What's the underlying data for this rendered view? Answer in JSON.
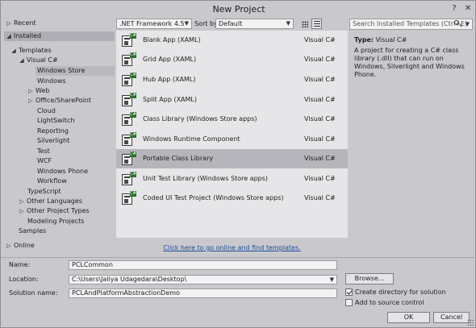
{
  "window": {
    "title": "New Project",
    "help_label": "?",
    "close_label": "✕"
  },
  "tree": [
    {
      "label": "Recent",
      "arrow": "▷",
      "kind": "collapsed"
    },
    {
      "label": "Installed",
      "arrow": "◢",
      "kind": "expanded-selected-parent"
    },
    {
      "label": "Templates",
      "arrow": "◢",
      "kind": "expanded"
    },
    {
      "label": "Visual C#",
      "arrow": "◢",
      "kind": "expanded"
    },
    {
      "label": "Windows Store",
      "arrow": "",
      "kind": "selected"
    },
    {
      "label": "Windows",
      "arrow": "",
      "kind": "leaf"
    },
    {
      "label": "Web",
      "arrow": "▷",
      "kind": "collapsed"
    },
    {
      "label": "Office/SharePoint",
      "arrow": "▷",
      "kind": "collapsed"
    },
    {
      "label": "Cloud",
      "arrow": "",
      "kind": "leaf"
    },
    {
      "label": "LightSwitch",
      "arrow": "",
      "kind": "leaf"
    },
    {
      "label": "Reporting",
      "arrow": "",
      "kind": "leaf"
    },
    {
      "label": "Silverlight",
      "arrow": "",
      "kind": "leaf"
    },
    {
      "label": "Test",
      "arrow": "",
      "kind": "leaf"
    },
    {
      "label": "WCF",
      "arrow": "",
      "kind": "leaf"
    },
    {
      "label": "Windows Phone",
      "arrow": "",
      "kind": "leaf"
    },
    {
      "label": "Workflow",
      "arrow": "",
      "kind": "leaf"
    },
    {
      "label": "TypeScript",
      "arrow": "",
      "kind": "leaf"
    },
    {
      "label": "Other Languages",
      "arrow": "▷",
      "kind": "collapsed"
    },
    {
      "label": "Other Project Types",
      "arrow": "▷",
      "kind": "collapsed"
    },
    {
      "label": "Modeling Projects",
      "arrow": "",
      "kind": "leaf"
    },
    {
      "label": "Samples",
      "arrow": "",
      "kind": "leaf"
    },
    {
      "label": "Online",
      "arrow": "▷",
      "kind": "collapsed"
    }
  ],
  "toolbar": {
    "framework": ".NET Framework 4.5",
    "sort_by_label": "Sort by:",
    "sort_value": "Default",
    "view_grid_icon": "small-icons-view-icon",
    "view_list_icon": "list-view-icon"
  },
  "templates": [
    {
      "name": "Blank App (XAML)",
      "lang": "Visual C#",
      "icon": "blank-app-icon",
      "selected": false
    },
    {
      "name": "Grid App (XAML)",
      "lang": "Visual C#",
      "icon": "grid-app-icon",
      "selected": false
    },
    {
      "name": "Hub App (XAML)",
      "lang": "Visual C#",
      "icon": "hub-app-icon",
      "selected": false
    },
    {
      "name": "Split App (XAML)",
      "lang": "Visual C#",
      "icon": "split-app-icon",
      "selected": false
    },
    {
      "name": "Class Library (Windows Store apps)",
      "lang": "Visual C#",
      "icon": "class-library-icon",
      "selected": false
    },
    {
      "name": "Windows Runtime Component",
      "lang": "Visual C#",
      "icon": "runtime-component-icon",
      "selected": false
    },
    {
      "name": "Portable Class Library",
      "lang": "Visual C#",
      "icon": "portable-library-icon",
      "selected": true
    },
    {
      "name": "Unit Test Library (Windows Store apps)",
      "lang": "Visual C#",
      "icon": "unit-test-icon",
      "selected": false
    },
    {
      "name": "Coded UI Test Project (Windows Store apps)",
      "lang": "Visual C#",
      "icon": "coded-ui-test-icon",
      "selected": false
    }
  ],
  "online_link": "Click here to go online and find templates.",
  "search": {
    "placeholder": "Search Installed Templates (Ctrl+E)"
  },
  "details": {
    "type_label": "Type:",
    "type_value": "Visual C#",
    "description": "A project for creating a C# class library (.dll) that can run on Windows, Silverlight and Windows Phone."
  },
  "form": {
    "name_label": "Name:",
    "name_value": "PCLCommon",
    "location_label": "Location:",
    "location_value": "C:\\Users\\Jaliya Udagedara\\Desktop\\",
    "solution_label": "Solution name:",
    "solution_value": "PCLAndPlatformAbstractionDemo",
    "browse_label": "Browse...",
    "create_dir_label": "Create directory for solution",
    "create_dir_checked": true,
    "source_control_label": "Add to source control",
    "source_control_checked": false,
    "ok_label": "OK",
    "cancel_label": "Cancel"
  }
}
